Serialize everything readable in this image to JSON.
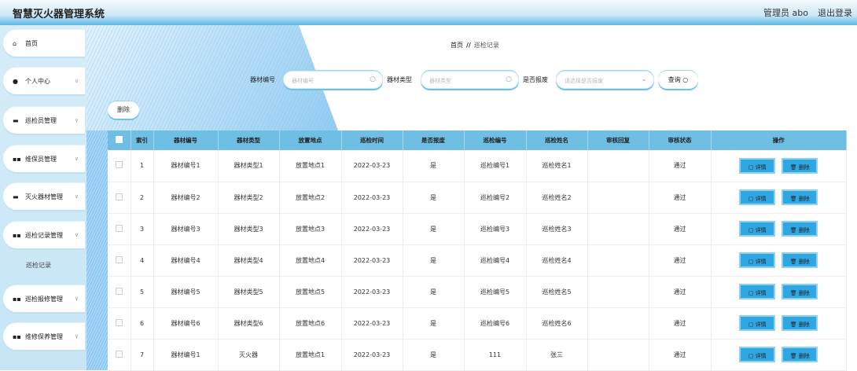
{
  "header": {
    "title": "智慧灭火器管理系统",
    "user": "管理员 abo",
    "logout": "退出登录"
  },
  "sidebar": {
    "items": [
      {
        "label": "首页",
        "icon": "home-icon"
      },
      {
        "label": "个人中心",
        "icon": "user-icon"
      },
      {
        "label": "巡检员管理",
        "icon": "briefcase-icon"
      },
      {
        "label": "维保员管理",
        "icon": "grid-icon"
      },
      {
        "label": "灭火器材管理",
        "icon": "monitor-icon"
      },
      {
        "label": "巡检记录管理",
        "icon": "grid-icon"
      },
      {
        "label": "巡检报修管理",
        "icon": "grid-icon"
      },
      {
        "label": "维修保养管理",
        "icon": "grid-icon"
      }
    ],
    "subitem": "巡检记录"
  },
  "breadcrumb": {
    "home": "首页",
    "sep": "//",
    "current": "巡检记录"
  },
  "search": {
    "f1_label": "器材编号",
    "f1_placeholder": "器材编号",
    "f2_label": "器材类型",
    "f2_placeholder": "器材类型",
    "f3_label": "是否报废",
    "f3_placeholder": "请选择是否报废",
    "query": "查询"
  },
  "toolbar": {
    "delete": "删除"
  },
  "table": {
    "headers": [
      "索引",
      "器材编号",
      "器材类型",
      "放置地点",
      "巡检时间",
      "是否报废",
      "巡检编号",
      "巡检姓名",
      "审核回复",
      "审核状态",
      "操作"
    ],
    "rows": [
      [
        "1",
        "器材编号1",
        "器材类型1",
        "放置地点1",
        "2022-03-23",
        "是",
        "巡检编号1",
        "巡检姓名1",
        "",
        "通过"
      ],
      [
        "2",
        "器材编号2",
        "器材类型2",
        "放置地点2",
        "2022-03-23",
        "是",
        "巡检编号2",
        "巡检姓名2",
        "",
        "通过"
      ],
      [
        "3",
        "器材编号3",
        "器材类型3",
        "放置地点3",
        "2022-03-23",
        "是",
        "巡检编号3",
        "巡检姓名3",
        "",
        "通过"
      ],
      [
        "4",
        "器材编号4",
        "器材类型4",
        "放置地点4",
        "2022-03-23",
        "是",
        "巡检编号4",
        "巡检姓名4",
        "",
        "通过"
      ],
      [
        "5",
        "器材编号5",
        "器材类型5",
        "放置地点5",
        "2022-03-23",
        "是",
        "巡检编号5",
        "巡检姓名5",
        "",
        "通过"
      ],
      [
        "6",
        "器材编号6",
        "器材类型6",
        "放置地点6",
        "2022-03-23",
        "是",
        "巡检编号6",
        "巡检姓名6",
        "",
        "通过"
      ],
      [
        "7",
        "器材编号1",
        "灭火器",
        "放置地点1",
        "2022-03-23",
        "是",
        "111",
        "张三",
        "",
        "通过"
      ]
    ],
    "detail": "详情",
    "delete": "删除"
  }
}
